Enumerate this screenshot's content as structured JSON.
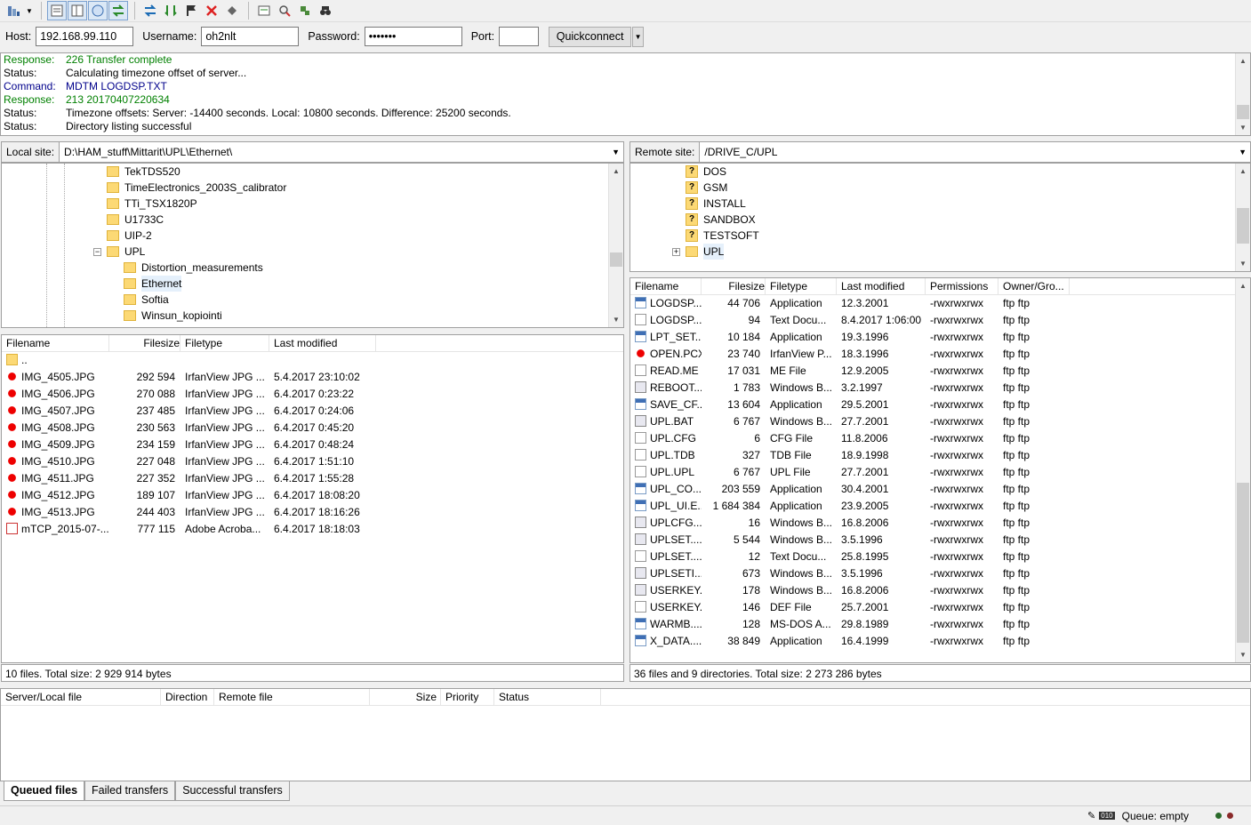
{
  "toolbar": {
    "icons": [
      "site-manager-icon",
      "dropdown-arrow-icon",
      "toggle-log-icon",
      "toggle-tree-icon",
      "toggle-remote-tree-icon",
      "toggle-queue-icon",
      "refresh-icon",
      "process-queue-icon",
      "cancel-icon",
      "disconnect-icon",
      "reconnect-icon",
      "filter-icon",
      "compare-icon",
      "sync-browse-icon",
      "find-icon"
    ]
  },
  "quickconnect": {
    "host_label": "Host:",
    "host_value": "192.168.99.110",
    "user_label": "Username:",
    "user_value": "oh2nlt",
    "pass_label": "Password:",
    "pass_value": "•••••••",
    "port_label": "Port:",
    "port_value": "",
    "button": "Quickconnect"
  },
  "log": [
    {
      "label": "Response:",
      "text": "226 Transfer complete",
      "color": "#008000"
    },
    {
      "label": "Status:",
      "text": "Calculating timezone offset of server...",
      "color": "#000000"
    },
    {
      "label": "Command:",
      "text": "MDTM LOGDSP.TXT",
      "color": "#00008b"
    },
    {
      "label": "Response:",
      "text": "213 20170407220634",
      "color": "#008000"
    },
    {
      "label": "Status:",
      "text": "Timezone offsets: Server: -14400 seconds. Local: 10800 seconds. Difference: 25200 seconds.",
      "color": "#000000"
    },
    {
      "label": "Status:",
      "text": "Directory listing successful",
      "color": "#000000"
    }
  ],
  "local": {
    "site_label": "Local site:",
    "path": "D:\\HAM_stuff\\Mittarit\\UPL\\Ethernet\\",
    "tree": [
      "TekTDS520",
      "TimeElectronics_2003S_calibrator",
      "TTi_TSX1820P",
      "U1733C",
      "UIP-2",
      "UPL",
      "Distortion_measurements",
      "Ethernet",
      "Softia",
      "Winsun_kopiointi"
    ],
    "columns": [
      "Filename",
      "Filesize",
      "Filetype",
      "Last modified"
    ],
    "files": [
      {
        "name": "..",
        "size": "",
        "type": "",
        "modified": "",
        "icon": "fold"
      },
      {
        "name": "IMG_4505.JPG",
        "size": "292 594",
        "type": "IrfanView JPG ...",
        "modified": "5.4.2017 23:10:02",
        "icon": "img"
      },
      {
        "name": "IMG_4506.JPG",
        "size": "270 088",
        "type": "IrfanView JPG ...",
        "modified": "6.4.2017 0:23:22",
        "icon": "img"
      },
      {
        "name": "IMG_4507.JPG",
        "size": "237 485",
        "type": "IrfanView JPG ...",
        "modified": "6.4.2017 0:24:06",
        "icon": "img"
      },
      {
        "name": "IMG_4508.JPG",
        "size": "230 563",
        "type": "IrfanView JPG ...",
        "modified": "6.4.2017 0:45:20",
        "icon": "img"
      },
      {
        "name": "IMG_4509.JPG",
        "size": "234 159",
        "type": "IrfanView JPG ...",
        "modified": "6.4.2017 0:48:24",
        "icon": "img"
      },
      {
        "name": "IMG_4510.JPG",
        "size": "227 048",
        "type": "IrfanView JPG ...",
        "modified": "6.4.2017 1:51:10",
        "icon": "img"
      },
      {
        "name": "IMG_4511.JPG",
        "size": "227 352",
        "type": "IrfanView JPG ...",
        "modified": "6.4.2017 1:55:28",
        "icon": "img"
      },
      {
        "name": "IMG_4512.JPG",
        "size": "189 107",
        "type": "IrfanView JPG ...",
        "modified": "6.4.2017 18:08:20",
        "icon": "img"
      },
      {
        "name": "IMG_4513.JPG",
        "size": "244 403",
        "type": "IrfanView JPG ...",
        "modified": "6.4.2017 18:16:26",
        "icon": "img"
      },
      {
        "name": "mTCP_2015-07-...",
        "size": "777 115",
        "type": "Adobe Acroba...",
        "modified": "6.4.2017 18:18:03",
        "icon": "pdf"
      }
    ],
    "status": "10 files. Total size: 2 929 914 bytes"
  },
  "remote": {
    "site_label": "Remote site:",
    "path": "/DRIVE_C/UPL",
    "tree": [
      "DOS",
      "GSM",
      "INSTALL",
      "SANDBOX",
      "TESTSOFT",
      "UPL"
    ],
    "columns": [
      "Filename",
      "Filesize",
      "Filetype",
      "Last modified",
      "Permissions",
      "Owner/Gro..."
    ],
    "files": [
      {
        "name": "LOGDSP....",
        "size": "44 706",
        "type": "Application",
        "modified": "12.3.2001",
        "perm": "-rwxrwxrwx",
        "owner": "ftp ftp",
        "icon": "app"
      },
      {
        "name": "LOGDSP....",
        "size": "94",
        "type": "Text Docu...",
        "modified": "8.4.2017 1:06:00",
        "perm": "-rwxrwxrwx",
        "owner": "ftp ftp",
        "icon": "doc"
      },
      {
        "name": "LPT_SET....",
        "size": "10 184",
        "type": "Application",
        "modified": "19.3.1996",
        "perm": "-rwxrwxrwx",
        "owner": "ftp ftp",
        "icon": "app"
      },
      {
        "name": "OPEN.PCX",
        "size": "23 740",
        "type": "IrfanView P...",
        "modified": "18.3.1996",
        "perm": "-rwxrwxrwx",
        "owner": "ftp ftp",
        "icon": "img"
      },
      {
        "name": "READ.ME",
        "size": "17 031",
        "type": "ME File",
        "modified": "12.9.2005",
        "perm": "-rwxrwxrwx",
        "owner": "ftp ftp",
        "icon": "doc"
      },
      {
        "name": "REBOOT....",
        "size": "1 783",
        "type": "Windows B...",
        "modified": "3.2.1997",
        "perm": "-rwxrwxrwx",
        "owner": "ftp ftp",
        "icon": "bat"
      },
      {
        "name": "SAVE_CF...",
        "size": "13 604",
        "type": "Application",
        "modified": "29.5.2001",
        "perm": "-rwxrwxrwx",
        "owner": "ftp ftp",
        "icon": "app"
      },
      {
        "name": "UPL.BAT",
        "size": "6 767",
        "type": "Windows B...",
        "modified": "27.7.2001",
        "perm": "-rwxrwxrwx",
        "owner": "ftp ftp",
        "icon": "bat"
      },
      {
        "name": "UPL.CFG",
        "size": "6",
        "type": "CFG File",
        "modified": "11.8.2006",
        "perm": "-rwxrwxrwx",
        "owner": "ftp ftp",
        "icon": "doc"
      },
      {
        "name": "UPL.TDB",
        "size": "327",
        "type": "TDB File",
        "modified": "18.9.1998",
        "perm": "-rwxrwxrwx",
        "owner": "ftp ftp",
        "icon": "doc"
      },
      {
        "name": "UPL.UPL",
        "size": "6 767",
        "type": "UPL File",
        "modified": "27.7.2001",
        "perm": "-rwxrwxrwx",
        "owner": "ftp ftp",
        "icon": "doc"
      },
      {
        "name": "UPL_CO...",
        "size": "203 559",
        "type": "Application",
        "modified": "30.4.2001",
        "perm": "-rwxrwxrwx",
        "owner": "ftp ftp",
        "icon": "app"
      },
      {
        "name": "UPL_UI.E...",
        "size": "1 684 384",
        "type": "Application",
        "modified": "23.9.2005",
        "perm": "-rwxrwxrwx",
        "owner": "ftp ftp",
        "icon": "app"
      },
      {
        "name": "UPLCFG....",
        "size": "16",
        "type": "Windows B...",
        "modified": "16.8.2006",
        "perm": "-rwxrwxrwx",
        "owner": "ftp ftp",
        "icon": "bat"
      },
      {
        "name": "UPLSET....",
        "size": "5 544",
        "type": "Windows B...",
        "modified": "3.5.1996",
        "perm": "-rwxrwxrwx",
        "owner": "ftp ftp",
        "icon": "bat"
      },
      {
        "name": "UPLSET....",
        "size": "12",
        "type": "Text Docu...",
        "modified": "25.8.1995",
        "perm": "-rwxrwxrwx",
        "owner": "ftp ftp",
        "icon": "doc"
      },
      {
        "name": "UPLSETI....",
        "size": "673",
        "type": "Windows B...",
        "modified": "3.5.1996",
        "perm": "-rwxrwxrwx",
        "owner": "ftp ftp",
        "icon": "bat"
      },
      {
        "name": "USERKEY....",
        "size": "178",
        "type": "Windows B...",
        "modified": "16.8.2006",
        "perm": "-rwxrwxrwx",
        "owner": "ftp ftp",
        "icon": "bat"
      },
      {
        "name": "USERKEY....",
        "size": "146",
        "type": "DEF File",
        "modified": "25.7.2001",
        "perm": "-rwxrwxrwx",
        "owner": "ftp ftp",
        "icon": "doc"
      },
      {
        "name": "WARMB....",
        "size": "128",
        "type": "MS-DOS A...",
        "modified": "29.8.1989",
        "perm": "-rwxrwxrwx",
        "owner": "ftp ftp",
        "icon": "app"
      },
      {
        "name": "X_DATA....",
        "size": "38 849",
        "type": "Application",
        "modified": "16.4.1999",
        "perm": "-rwxrwxrwx",
        "owner": "ftp ftp",
        "icon": "app"
      }
    ],
    "status": "36 files and 9 directories. Total size: 2 273 286 bytes"
  },
  "queue": {
    "columns": [
      "Server/Local file",
      "Direction",
      "Remote file",
      "Size",
      "Priority",
      "Status"
    ]
  },
  "tabs": [
    "Queued files",
    "Failed transfers",
    "Successful transfers"
  ],
  "bottom": {
    "queue_status": "Queue: empty"
  }
}
